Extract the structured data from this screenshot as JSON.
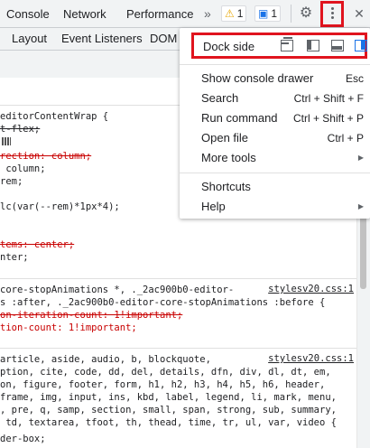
{
  "top_tabs": [
    "Console",
    "Network",
    "Performance"
  ],
  "more_tabs_glyph": "»",
  "warnings": {
    "icon": "warning-icon",
    "count": "1"
  },
  "messages": {
    "icon": "message-icon",
    "count": "1"
  },
  "toolbar_icons": [
    "gear-icon",
    "kebab-menu-icon",
    "close-icon"
  ],
  "close_glyph": "✕",
  "sub_tabs": [
    "Layout",
    "Event Listeners",
    "DOM"
  ],
  "code": {
    "block1": [
      "editorContentWrap {",
      "t-flex;",
      "rection: column;",
      " column;",
      "rem;",
      "lc(var(--rem)*1px*4);",
      "tems: center;",
      "nter;"
    ],
    "block2": {
      "selector1": "core-stopAnimations *, ._2ac900b0-editor-",
      "selector2": "s :after, ._2ac900b0-editor-core-stopAnimations :before {",
      "link": "stylesv20.css:1",
      "decl1": "on-iteration-count: 1!important;",
      "decl2": "tion-count: 1!important;"
    },
    "block3": {
      "link": "stylesv20.css:1",
      "lines": [
        "article, aside, audio, b, blockquote,",
        "ption, cite, code, dd, del, details, dfn, div, dl, dt, em,",
        "on, figure, footer, form, h1, h2, h3, h4, h5, h6, header,",
        "frame, img, input, ins, kbd, label, legend, li, mark, menu,",
        ", pre, q, samp, section, small, span, strong, sub, summary,",
        " td, textarea, tfoot, th, thead, time, tr, ul, var, video {",
        "der-box;"
      ]
    }
  },
  "menu": {
    "dock_side_label": "Dock side",
    "dock_options": [
      "undock-icon",
      "dock-left-icon",
      "dock-bottom-icon",
      "dock-right-icon"
    ],
    "active_dock": "dock-right-icon",
    "group1": [
      {
        "label": "Show console drawer",
        "shortcut": "Esc"
      },
      {
        "label": "Search",
        "shortcut": "Ctrl + Shift + F"
      },
      {
        "label": "Run command",
        "shortcut": "Ctrl + Shift + P"
      },
      {
        "label": "Open file",
        "shortcut": "Ctrl + P"
      },
      {
        "label": "More tools",
        "submenu": "▶"
      }
    ],
    "group2": [
      {
        "label": "Shortcuts"
      },
      {
        "label": "Help",
        "submenu": "▶"
      }
    ]
  },
  "colors": {
    "highlight_border": "#e0141e",
    "accent": "#1a73e8",
    "property_red": "#c80000"
  }
}
